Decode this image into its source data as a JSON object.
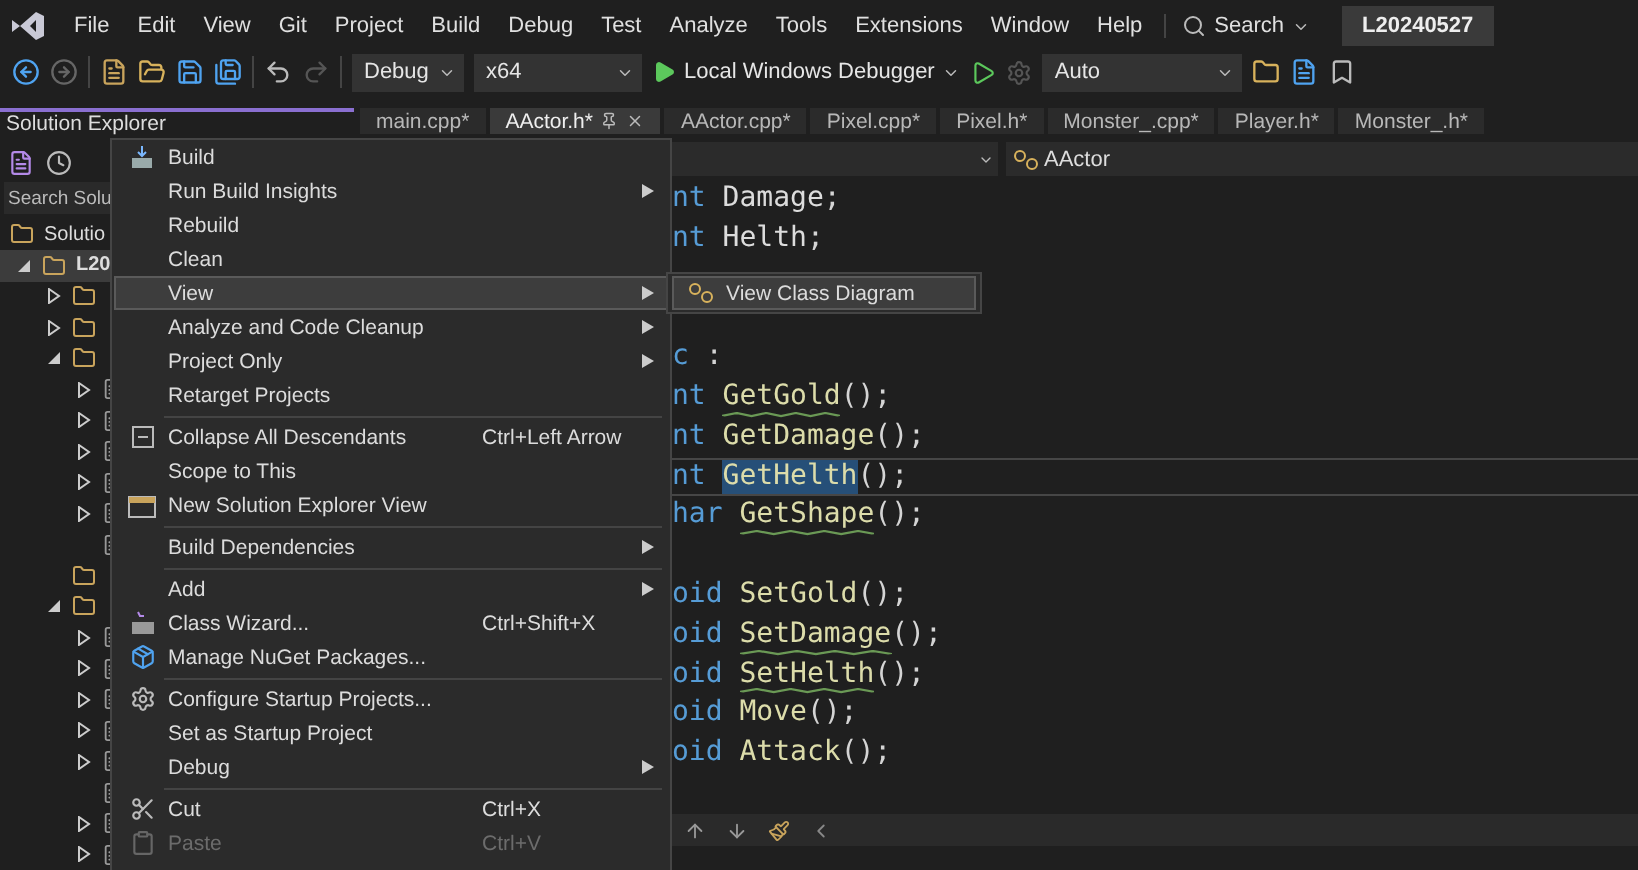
{
  "menu_bar": {
    "items": [
      "File",
      "Edit",
      "View",
      "Git",
      "Project",
      "Build",
      "Debug",
      "Test",
      "Analyze",
      "Tools",
      "Extensions",
      "Window",
      "Help"
    ],
    "search": "Search",
    "solution_name": "L20240527"
  },
  "toolbar": {
    "configuration": "Debug",
    "platform": "x64",
    "debugger": "Local Windows Debugger",
    "dropdown_3": "Auto"
  },
  "solution_explorer": {
    "title": "Solution Explorer",
    "search_placeholder": "Search Solu",
    "tree": [
      {
        "label": "Solutio",
        "selected": false,
        "expanded": true,
        "children": [
          {
            "label": "L20",
            "selected": true,
            "expanded": true,
            "children": [
              {
                "has_children": true,
                "expanded": false
              },
              {
                "has_children": true,
                "expanded": false
              },
              {
                "has_children": true,
                "expanded": true,
                "children": [
                  {
                    "has_children": true,
                    "expanded": false
                  },
                  {
                    "has_children": true,
                    "expanded": false
                  },
                  {
                    "has_children": true,
                    "expanded": false
                  },
                  {
                    "has_children": true,
                    "expanded": false
                  },
                  {
                    "has_children": true,
                    "expanded": false
                  },
                  {
                    "has_children": false,
                    "expanded": false
                  }
                ]
              },
              {
                "has_children": false,
                "expanded": false
              },
              {
                "has_children": true,
                "expanded": true,
                "children": [
                  {
                    "has_children": true,
                    "expanded": false
                  },
                  {
                    "has_children": true,
                    "expanded": false
                  },
                  {
                    "has_children": true,
                    "expanded": false
                  },
                  {
                    "has_children": true,
                    "expanded": false
                  },
                  {
                    "has_children": true,
                    "expanded": false
                  },
                  {
                    "has_children": false,
                    "expanded": false
                  },
                  {
                    "has_children": true,
                    "expanded": false
                  },
                  {
                    "has_children": true,
                    "expanded": false
                  }
                ]
              }
            ]
          }
        ]
      }
    ]
  },
  "editor_tabs": [
    {
      "label": "main.cpp*",
      "selected": false
    },
    {
      "label": "AActor.h*",
      "selected": true
    },
    {
      "label": "AActor.cpp*",
      "selected": false
    },
    {
      "label": "Pixel.cpp*",
      "selected": false
    },
    {
      "label": "Pixel.h*",
      "selected": false
    },
    {
      "label": "Monster_.cpp*",
      "selected": false
    },
    {
      "label": "Player.h*",
      "selected": false
    },
    {
      "label": "Monster_.h*",
      "selected": false
    }
  ],
  "nav_bar": {
    "class_name": "AActor"
  },
  "code_lines": [
    {
      "kind": "field",
      "keyword": "nt",
      "name": "Damage",
      "rest": ";",
      "squiggle": false,
      "selected": false
    },
    {
      "kind": "field",
      "keyword": "nt",
      "name": "Helth",
      "rest": ";",
      "squiggle": false,
      "selected": false
    },
    {
      "kind": "blank"
    },
    {
      "kind": "blank"
    },
    {
      "kind": "label",
      "keyword": "c",
      "rest": " :"
    },
    {
      "kind": "method",
      "keyword": "nt",
      "name": "GetGold",
      "rest": "();",
      "squiggle": true,
      "selected": false
    },
    {
      "kind": "method",
      "keyword": "nt",
      "name": "GetDamage",
      "rest": "();",
      "squiggle": false,
      "selected": false
    },
    {
      "kind": "method",
      "keyword": "nt",
      "name": "GetHelth",
      "rest": "();",
      "squiggle": false,
      "selected": true
    },
    {
      "kind": "method",
      "keyword": "har",
      "name": "GetShape",
      "rest": "();",
      "squiggle": true,
      "selected": false
    },
    {
      "kind": "blank"
    },
    {
      "kind": "method",
      "keyword": "oid",
      "name": "SetGold",
      "rest": "();",
      "squiggle": false,
      "selected": false
    },
    {
      "kind": "method",
      "keyword": "oid",
      "name": "SetDamage",
      "rest": "();",
      "squiggle": true,
      "selected": false
    },
    {
      "kind": "method",
      "keyword": "oid",
      "name": "SetHelth",
      "rest": "();",
      "squiggle": true,
      "selected": false
    },
    {
      "kind": "method",
      "keyword": "oid",
      "name": "Move",
      "rest": "();",
      "squiggle": false,
      "selected": false
    },
    {
      "kind": "method",
      "keyword": "oid",
      "name": "Attack",
      "rest": "();",
      "squiggle": false,
      "selected": false
    }
  ],
  "context_menu": {
    "items": [
      {
        "kind": "item",
        "label": "Build",
        "submenu": false,
        "disabled": false,
        "selected": false
      },
      {
        "kind": "item",
        "label": "Run Build Insights",
        "submenu": true,
        "disabled": false,
        "selected": false
      },
      {
        "kind": "item",
        "label": "Rebuild",
        "submenu": false,
        "disabled": false,
        "selected": false
      },
      {
        "kind": "item",
        "label": "Clean",
        "submenu": false,
        "disabled": false,
        "selected": false
      },
      {
        "kind": "item",
        "label": "View",
        "submenu": true,
        "disabled": false,
        "selected": true
      },
      {
        "kind": "item",
        "label": "Analyze and Code Cleanup",
        "submenu": true,
        "disabled": false,
        "selected": false
      },
      {
        "kind": "item",
        "label": "Project Only",
        "submenu": true,
        "disabled": false,
        "selected": false
      },
      {
        "kind": "item",
        "label": "Retarget Projects",
        "submenu": false,
        "disabled": false,
        "selected": false
      },
      {
        "kind": "separator"
      },
      {
        "kind": "item",
        "label": "Collapse All Descendants",
        "shortcut": "Ctrl+Left Arrow",
        "submenu": false,
        "disabled": false,
        "selected": false
      },
      {
        "kind": "item",
        "label": "Scope to This",
        "submenu": false,
        "disabled": false,
        "selected": false
      },
      {
        "kind": "item",
        "label": "New Solution Explorer View",
        "submenu": false,
        "disabled": false,
        "selected": false
      },
      {
        "kind": "separator"
      },
      {
        "kind": "item",
        "label": "Build Dependencies",
        "submenu": true,
        "disabled": false,
        "selected": false
      },
      {
        "kind": "separator"
      },
      {
        "kind": "item",
        "label": "Add",
        "submenu": true,
        "disabled": false,
        "selected": false
      },
      {
        "kind": "item",
        "label": "Class Wizard...",
        "shortcut": "Ctrl+Shift+X",
        "submenu": false,
        "disabled": false,
        "selected": false
      },
      {
        "kind": "item",
        "label": "Manage NuGet Packages...",
        "submenu": false,
        "disabled": false,
        "selected": false
      },
      {
        "kind": "separator"
      },
      {
        "kind": "item",
        "label": "Configure Startup Projects...",
        "submenu": false,
        "disabled": false,
        "selected": false
      },
      {
        "kind": "item",
        "label": "Set as Startup Project",
        "submenu": false,
        "disabled": false,
        "selected": false
      },
      {
        "kind": "item",
        "label": "Debug",
        "submenu": true,
        "disabled": false,
        "selected": false
      },
      {
        "kind": "separator"
      },
      {
        "kind": "item",
        "label": "Cut",
        "shortcut": "Ctrl+X",
        "submenu": false,
        "disabled": false,
        "selected": false
      },
      {
        "kind": "item",
        "label": "Paste",
        "shortcut": "Ctrl+V",
        "submenu": false,
        "disabled": true,
        "selected": false
      }
    ]
  },
  "submenu": {
    "items": [
      {
        "label": "View Class Diagram",
        "selected": true
      }
    ]
  }
}
